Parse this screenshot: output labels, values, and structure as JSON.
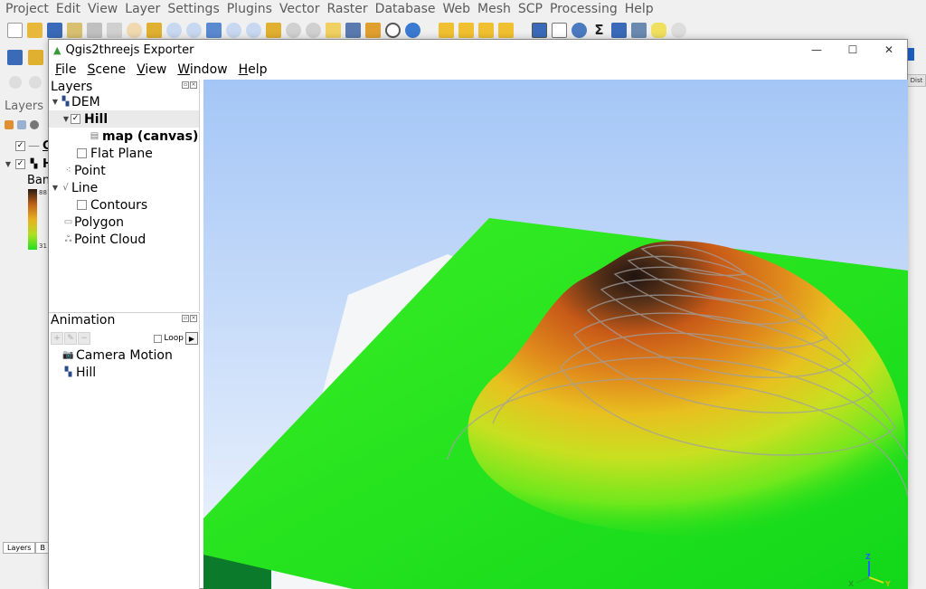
{
  "qgis": {
    "menu": [
      "Project",
      "Edit",
      "View",
      "Layer",
      "Settings",
      "Plugins",
      "Vector",
      "Raster",
      "Database",
      "Web",
      "Mesh",
      "SCP",
      "Processing",
      "Help"
    ],
    "layers_panel_title": "Layers",
    "layer_c_label": "C",
    "layer_h_label": "H",
    "band_label": "Ban",
    "ramp_max": "88",
    "ramp_min": "31",
    "bottom_tabs": [
      "Layers",
      "B"
    ],
    "right_strip": "Dist"
  },
  "exporter": {
    "title": "Qgis2threejs Exporter",
    "menu": [
      "File",
      "Scene",
      "View",
      "Window",
      "Help"
    ],
    "layers_dock": {
      "title": "Layers",
      "tree": [
        {
          "label": "DEM",
          "icon": "dem-icon",
          "expanded": true
        },
        {
          "label": "Hill",
          "checked": true,
          "selected": true
        },
        {
          "label": "map (canvas)"
        },
        {
          "label": "Flat Plane",
          "checked": false
        },
        {
          "label": "Point",
          "icon": "point-icon"
        },
        {
          "label": "Line",
          "icon": "line-icon",
          "expanded": true
        },
        {
          "label": "Contours",
          "checked": false
        },
        {
          "label": "Polygon",
          "icon": "polygon-icon"
        },
        {
          "label": "Point Cloud",
          "icon": "point-cloud-icon"
        }
      ]
    },
    "animation_dock": {
      "title": "Animation",
      "loop_label": "Loop",
      "loop_checked": false,
      "items": [
        {
          "label": "Camera Motion",
          "icon": "camera-icon"
        },
        {
          "label": "Hill",
          "icon": "dem-icon"
        }
      ]
    },
    "axes": {
      "z": "Z",
      "x": "X",
      "y": "Y"
    },
    "colors": {
      "sky_top": "#a4c6f6",
      "sky_bottom": "#eef5ff",
      "terrain_low": "#14e01c",
      "terrain_mid": "#d8e020",
      "terrain_high": "#c85a18",
      "terrain_peak": "#2a1810"
    }
  }
}
